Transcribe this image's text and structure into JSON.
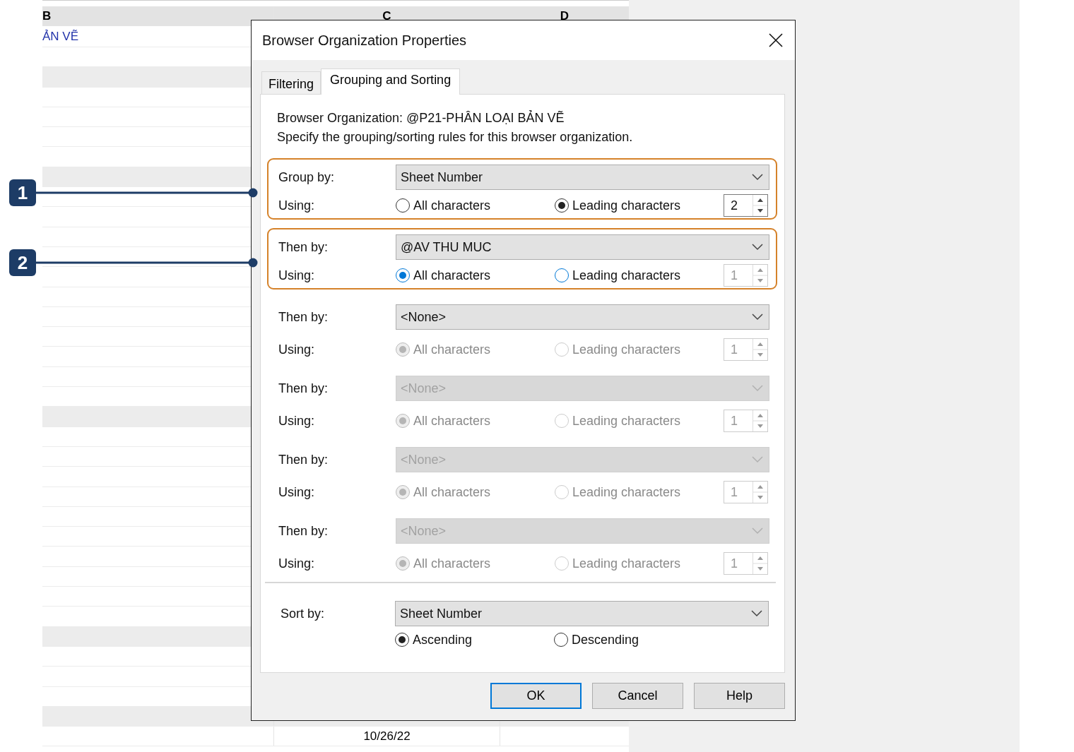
{
  "sheet": {
    "columns": [
      "B",
      "C",
      "D"
    ],
    "top_cell_text": "ẢN VẼ",
    "bottom_cell_text": "10/26/22"
  },
  "dialog": {
    "title": "Browser Organization Properties",
    "tabs": [
      {
        "label": "Filtering",
        "selected": false
      },
      {
        "label": "Grouping and Sorting",
        "selected": true
      }
    ],
    "organization_line": "Browser Organization: @P21-PHÂN LOẠI BẢN VẼ",
    "instruction": "Specify the grouping/sorting rules for this browser organization.",
    "rules": [
      {
        "label": "Group by:",
        "value": "Sheet Number",
        "dropdown_disabled": false,
        "using_label": "Using:",
        "options_disabled": false,
        "focused": false,
        "options": [
          {
            "label": "All characters",
            "selected": false
          },
          {
            "label": "Leading characters",
            "selected": true
          }
        ],
        "count": "2",
        "count_disabled": false,
        "callout": "1"
      },
      {
        "label": "Then by:",
        "value": "@AV THU MUC",
        "dropdown_disabled": false,
        "using_label": "Using:",
        "options_disabled": false,
        "focused": true,
        "options": [
          {
            "label": "All characters",
            "selected": true
          },
          {
            "label": "Leading characters",
            "selected": false
          }
        ],
        "count": "1",
        "count_disabled": true,
        "callout": "2"
      },
      {
        "label": "Then by:",
        "value": "<None>",
        "dropdown_disabled": false,
        "using_label": "Using:",
        "options_disabled": true,
        "options": [
          {
            "label": "All characters",
            "selected": true
          },
          {
            "label": "Leading characters",
            "selected": false
          }
        ],
        "count": "1",
        "count_disabled": true
      },
      {
        "label": "Then by:",
        "value": "<None>",
        "dropdown_disabled": true,
        "using_label": "Using:",
        "options_disabled": true,
        "options": [
          {
            "label": "All characters",
            "selected": true
          },
          {
            "label": "Leading characters",
            "selected": false
          }
        ],
        "count": "1",
        "count_disabled": true
      },
      {
        "label": "Then by:",
        "value": "<None>",
        "dropdown_disabled": true,
        "using_label": "Using:",
        "options_disabled": true,
        "options": [
          {
            "label": "All characters",
            "selected": true
          },
          {
            "label": "Leading characters",
            "selected": false
          }
        ],
        "count": "1",
        "count_disabled": true
      },
      {
        "label": "Then by:",
        "value": "<None>",
        "dropdown_disabled": true,
        "using_label": "Using:",
        "options_disabled": true,
        "options": [
          {
            "label": "All characters",
            "selected": true
          },
          {
            "label": "Leading characters",
            "selected": false
          }
        ],
        "count": "1",
        "count_disabled": true
      }
    ],
    "sort": {
      "label": "Sort by:",
      "value": "Sheet Number",
      "options": [
        {
          "label": "Ascending",
          "selected": true
        },
        {
          "label": "Descending",
          "selected": false
        }
      ]
    },
    "buttons": [
      {
        "label": "OK",
        "default": true
      },
      {
        "label": "Cancel",
        "default": false
      },
      {
        "label": "Help",
        "default": false
      }
    ]
  }
}
